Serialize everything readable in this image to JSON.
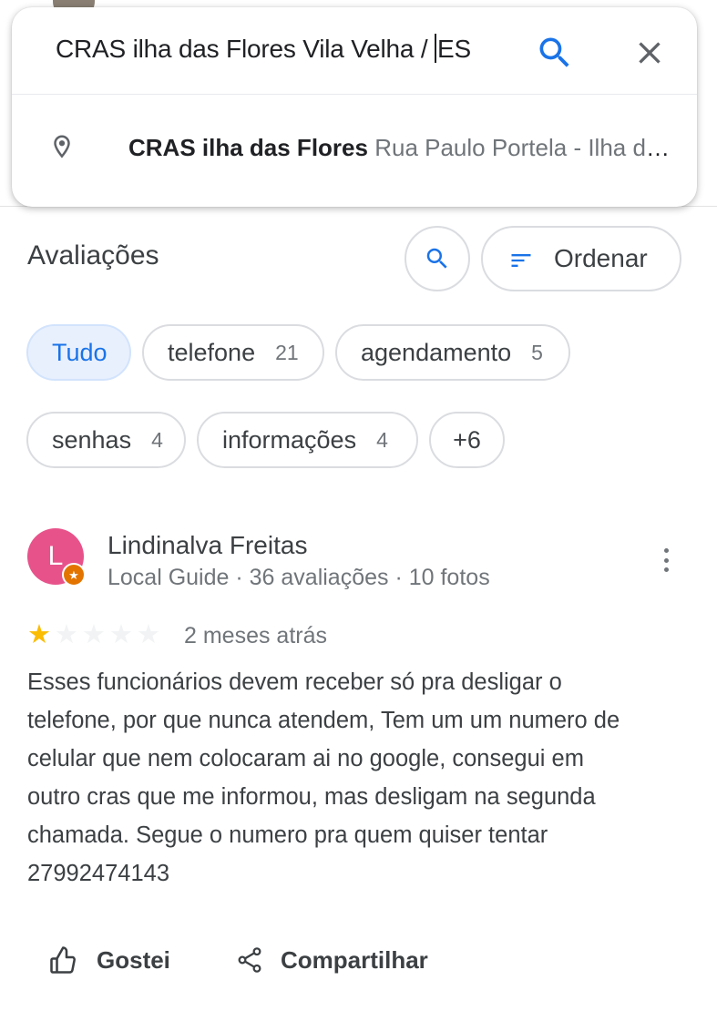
{
  "search": {
    "query_before_caret": "CRAS ilha das Flores Vila Velha / ",
    "query_after_caret": "ES"
  },
  "suggestion": {
    "name": "CRAS ilha das Flores",
    "address": "Rua Paulo Portela - Ilha das Flores, Vila Velha - ES"
  },
  "reviews": {
    "title": "Avaliações",
    "sort_label": "Ordenar",
    "chips": [
      {
        "label": "Tudo",
        "count": ""
      },
      {
        "label": "telefone",
        "count": "21"
      },
      {
        "label": "agendamento",
        "count": "5"
      },
      {
        "label": "senhas",
        "count": "4"
      },
      {
        "label": "informações",
        "count": "4"
      },
      {
        "label": "+6",
        "count": ""
      }
    ]
  },
  "review": {
    "avatar_letter": "L",
    "avatar_color": "#e8528b",
    "name": "Lindinalva Freitas",
    "meta": "Local Guide · 36 avaliações · 10 fotos",
    "rating": 1,
    "rating_max": 5,
    "date": "2 meses atrás",
    "text": "Esses funcionários devem receber só pra desligar o\ntelefone, por que nunca atendem, Tem um um numero de\ncelular que nem colocaram ai no google, consegui em\noutro cras que me informou, mas desligam na segunda\nchamada. Segue o numero pra quem quiser tentar\n27992474143",
    "like_label": "Gostei",
    "share_label": "Compartilhar"
  },
  "colors": {
    "accent": "#1a73e8",
    "star": "#fbbc04",
    "chip_active_bg": "#e8f0fe",
    "badge": "#e37400"
  }
}
